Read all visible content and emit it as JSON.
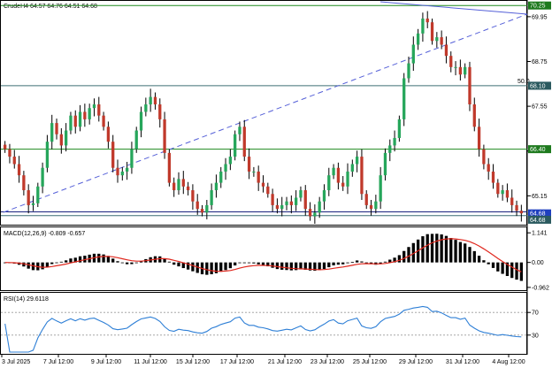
{
  "main_header": "CrudeH4  64.57 64.76 64.51 64.68",
  "macd_header": "MACD(12,26,9) -0.809 -0.657",
  "rsi_header": "RSI(14) 29.6118",
  "fib_label": "50.0",
  "colors": {
    "up": "#26a65b",
    "down": "#c0392b",
    "wick": "#000000",
    "hline_green": "#1f8a1f",
    "hline_teal": "#3d6f75",
    "hline_blue": "#1a237e",
    "trend_dashed": "#5560d8",
    "signal": "#e0281e",
    "rsi": "#2e7fd6",
    "price_tag_green": "#1e7a1e",
    "price_tag_blue": "#1f3fbf",
    "price_tag_teal": "#2b5a5f"
  },
  "chart_data": [
    {
      "type": "candlestick",
      "title": "CrudeH4  64.57 64.76 64.51 64.68",
      "y_ticks": [
        "69.95",
        "68.75",
        "67.55",
        "66.35",
        "65.15"
      ],
      "ylim": [
        64.4,
        70.35
      ],
      "x_ticks": [
        "3 Jul 2025",
        "7 Jul 12:00",
        "9 Jul 12:00",
        "11 Jul 12:00",
        "15 Jul 12:00",
        "17 Jul 12:00",
        "21 Jul 12:00",
        "23 Jul 12:00",
        "25 Jul 12:00",
        "29 Jul 12:00",
        "31 Jul 12:00",
        "4 Aug 12:00"
      ],
      "price_tags": [
        {
          "label": "70.25",
          "value": 70.25,
          "color": "green"
        },
        {
          "label": "68.10",
          "value": 68.1,
          "color": "teal"
        },
        {
          "label": "66.40",
          "value": 66.4,
          "color": "green"
        },
        {
          "label": "64.68",
          "value": 64.68,
          "color": "blue"
        },
        {
          "label": "64.68",
          "value": 64.58,
          "color": "teal"
        }
      ],
      "horizontal_lines": [
        70.25,
        68.1,
        66.4,
        64.72,
        64.62
      ],
      "closes": [
        66.4,
        66.2,
        66.0,
        65.7,
        65.3,
        64.9,
        64.95,
        65.4,
        65.9,
        66.6,
        67.1,
        66.8,
        66.5,
        66.9,
        67.3,
        67.0,
        67.4,
        67.2,
        67.5,
        67.6,
        67.3,
        67.0,
        66.6,
        65.9,
        65.7,
        65.8,
        65.9,
        66.4,
        66.9,
        67.4,
        67.6,
        67.8,
        67.6,
        67.2,
        66.3,
        65.5,
        65.3,
        65.6,
        65.4,
        65.3,
        65.0,
        64.8,
        64.7,
        64.9,
        65.3,
        65.5,
        65.8,
        66.0,
        66.2,
        66.8,
        67.0,
        66.2,
        65.8,
        65.8,
        65.5,
        65.4,
        65.2,
        64.9,
        64.8,
        64.9,
        65.0,
        64.9,
        65.1,
        65.3,
        64.8,
        64.6,
        64.7,
        65.0,
        65.3,
        65.7,
        65.9,
        65.5,
        65.4,
        65.8,
        66.0,
        66.2,
        65.2,
        64.9,
        64.8,
        65.0,
        65.7,
        66.3,
        66.5,
        66.7,
        67.2,
        68.3,
        68.7,
        69.2,
        69.5,
        69.9,
        69.8,
        69.3,
        69.4,
        69.2,
        68.9,
        68.6,
        68.6,
        68.4,
        68.6,
        67.6,
        67.0,
        66.4,
        66.0,
        65.8,
        65.5,
        65.2,
        65.3,
        65.1,
        64.9,
        64.75,
        64.68
      ],
      "macd_ylim": [
        -1.0,
        1.25
      ],
      "macd_ticks": [
        "1.141",
        "0.00",
        "-0.962"
      ],
      "rsi_ylim": [
        0,
        100
      ],
      "rsi_ticks": [
        "70",
        "30"
      ]
    }
  ]
}
